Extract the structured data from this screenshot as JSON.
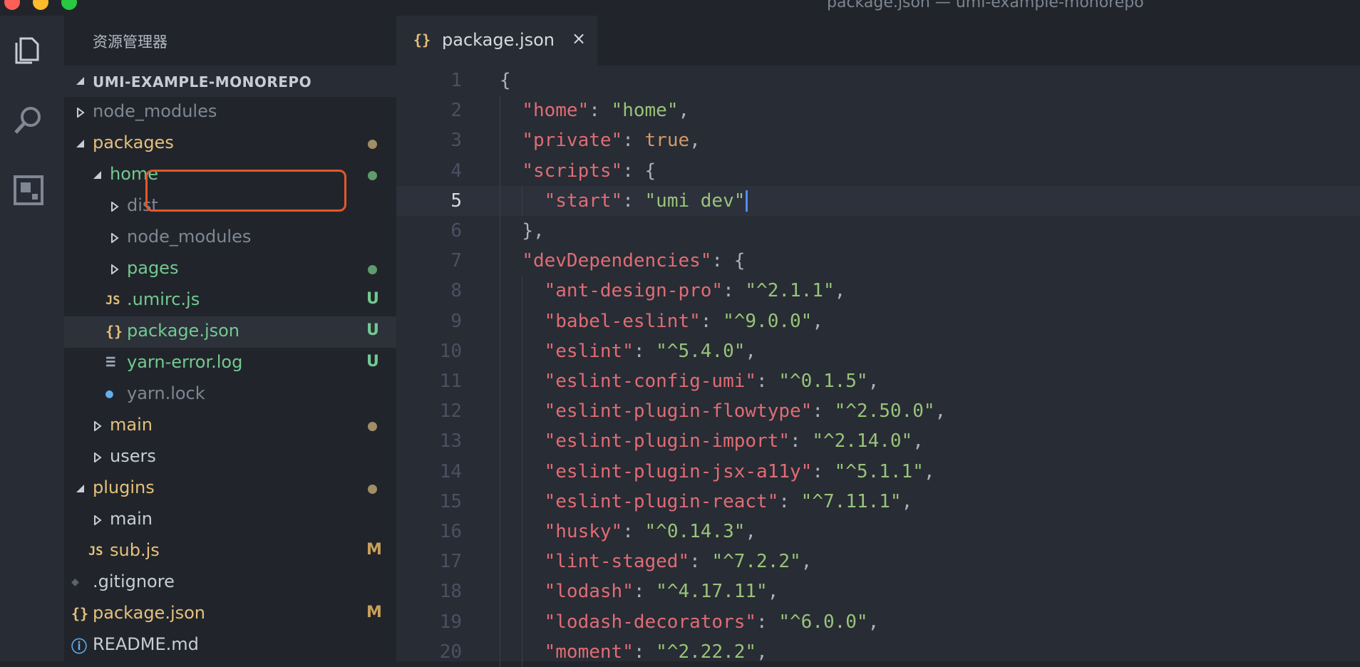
{
  "window": {
    "title": "package.json — umi-example-monorepo"
  },
  "colors": {
    "close": "#fe5f57",
    "minimize": "#febb2e",
    "zoom": "#28c840",
    "highlight_box": "#e2582b"
  },
  "activity_bar": {
    "icons": [
      "files-icon",
      "search-icon",
      "extensions-icon"
    ]
  },
  "sidebar": {
    "title": "资源管理器",
    "root": "UMI-EXAMPLE-MONOREPO",
    "items": [
      {
        "label": "node_modules",
        "indent": 1,
        "arrow": "right",
        "icon": "",
        "color": "#7f8794",
        "mark": "",
        "mark_type": ""
      },
      {
        "label": "packages",
        "indent": 1,
        "arrow": "down",
        "icon": "",
        "color": "#e5c07b",
        "mark": "",
        "mark_type": "dot",
        "mark_color": "#a18d66"
      },
      {
        "label": "home",
        "indent": 2,
        "arrow": "down",
        "icon": "",
        "color": "#73c991",
        "mark": "",
        "mark_type": "dot",
        "mark_color": "#5f9b6c"
      },
      {
        "label": "dist",
        "indent": 3,
        "arrow": "right",
        "icon": "",
        "color": "#7f8794",
        "mark": "",
        "mark_type": ""
      },
      {
        "label": "node_modules",
        "indent": 3,
        "arrow": "right",
        "icon": "",
        "color": "#7f8794",
        "mark": "",
        "mark_type": ""
      },
      {
        "label": "pages",
        "indent": 3,
        "arrow": "right",
        "icon": "",
        "color": "#73c991",
        "mark": "",
        "mark_type": "dot",
        "mark_color": "#5f9b6c"
      },
      {
        "label": ".umirc.js",
        "indent": 3,
        "arrow": "",
        "icon": "JS",
        "icon_color": "#e5c07b",
        "color": "#73c991",
        "mark": "U",
        "mark_type": "badge",
        "mark_color": "#73c991"
      },
      {
        "label": "package.json",
        "indent": 3,
        "arrow": "",
        "icon": "{}",
        "icon_color": "#e5c07b",
        "color": "#73c991",
        "mark": "U",
        "mark_type": "badge",
        "mark_color": "#73c991",
        "selected": true
      },
      {
        "label": "yarn-error.log",
        "indent": 3,
        "arrow": "",
        "icon": "≡",
        "icon_color": "#9da5b4",
        "color": "#73c991",
        "mark": "U",
        "mark_type": "badge",
        "mark_color": "#73c991"
      },
      {
        "label": "yarn.lock",
        "indent": 3,
        "arrow": "",
        "icon": "yarn",
        "icon_color": "#61afef",
        "color": "#7f8794",
        "mark": "",
        "mark_type": ""
      },
      {
        "label": "main",
        "indent": 2,
        "arrow": "right",
        "icon": "",
        "color": "#e5c07b",
        "mark": "",
        "mark_type": "dot",
        "mark_color": "#a18d66"
      },
      {
        "label": "users",
        "indent": 2,
        "arrow": "right",
        "icon": "",
        "color": "#c8ccd4",
        "mark": "",
        "mark_type": ""
      },
      {
        "label": "plugins",
        "indent": 1,
        "arrow": "down",
        "icon": "",
        "color": "#e5c07b",
        "mark": "",
        "mark_type": "dot",
        "mark_color": "#a18d66"
      },
      {
        "label": "main",
        "indent": 2,
        "arrow": "right",
        "icon": "",
        "color": "#c8ccd4",
        "mark": "",
        "mark_type": ""
      },
      {
        "label": "sub.js",
        "indent": 2,
        "arrow": "",
        "icon": "JS",
        "icon_color": "#e5c07b",
        "color": "#e5c07b",
        "mark": "M",
        "mark_type": "badge",
        "mark_color": "#c7a05a"
      },
      {
        "label": ".gitignore",
        "indent": 1,
        "arrow": "",
        "icon": "git",
        "icon_color": "#5c6370",
        "color": "#c8ccd4",
        "mark": "",
        "mark_type": ""
      },
      {
        "label": "package.json",
        "indent": 1,
        "arrow": "",
        "icon": "{}",
        "icon_color": "#e5c07b",
        "color": "#e5c07b",
        "mark": "M",
        "mark_type": "badge",
        "mark_color": "#c7a05a"
      },
      {
        "label": "README.md",
        "indent": 1,
        "arrow": "",
        "icon": "info",
        "icon_color": "#61afef",
        "color": "#c8ccd4",
        "mark": "",
        "mark_type": ""
      }
    ]
  },
  "tab": {
    "icon": "{}",
    "label": "package.json",
    "close": "×"
  },
  "editor": {
    "active_line": 5,
    "lines": [
      {
        "n": 1,
        "depth": 0,
        "tokens": [
          [
            "p",
            "{"
          ]
        ]
      },
      {
        "n": 2,
        "depth": 1,
        "tokens": [
          [
            "k",
            "\"home\""
          ],
          [
            "p",
            ": "
          ],
          [
            "s",
            "\"home\""
          ],
          [
            "p",
            ","
          ]
        ]
      },
      {
        "n": 3,
        "depth": 1,
        "tokens": [
          [
            "k",
            "\"private\""
          ],
          [
            "p",
            ": "
          ],
          [
            "b",
            "true"
          ],
          [
            "p",
            ","
          ]
        ]
      },
      {
        "n": 4,
        "depth": 1,
        "tokens": [
          [
            "k",
            "\"scripts\""
          ],
          [
            "p",
            ": {"
          ]
        ]
      },
      {
        "n": 5,
        "depth": 2,
        "tokens": [
          [
            "k",
            "\"start\""
          ],
          [
            "p",
            ": "
          ],
          [
            "s",
            "\"umi dev\""
          ]
        ],
        "cursor": true
      },
      {
        "n": 6,
        "depth": 1,
        "tokens": [
          [
            "p",
            "},"
          ]
        ]
      },
      {
        "n": 7,
        "depth": 1,
        "tokens": [
          [
            "k",
            "\"devDependencies\""
          ],
          [
            "p",
            ": {"
          ]
        ]
      },
      {
        "n": 8,
        "depth": 2,
        "tokens": [
          [
            "k",
            "\"ant-design-pro\""
          ],
          [
            "p",
            ": "
          ],
          [
            "s",
            "\"^2.1.1\""
          ],
          [
            "p",
            ","
          ]
        ]
      },
      {
        "n": 9,
        "depth": 2,
        "tokens": [
          [
            "k",
            "\"babel-eslint\""
          ],
          [
            "p",
            ": "
          ],
          [
            "s",
            "\"^9.0.0\""
          ],
          [
            "p",
            ","
          ]
        ]
      },
      {
        "n": 10,
        "depth": 2,
        "tokens": [
          [
            "k",
            "\"eslint\""
          ],
          [
            "p",
            ": "
          ],
          [
            "s",
            "\"^5.4.0\""
          ],
          [
            "p",
            ","
          ]
        ]
      },
      {
        "n": 11,
        "depth": 2,
        "tokens": [
          [
            "k",
            "\"eslint-config-umi\""
          ],
          [
            "p",
            ": "
          ],
          [
            "s",
            "\"^0.1.5\""
          ],
          [
            "p",
            ","
          ]
        ]
      },
      {
        "n": 12,
        "depth": 2,
        "tokens": [
          [
            "k",
            "\"eslint-plugin-flowtype\""
          ],
          [
            "p",
            ": "
          ],
          [
            "s",
            "\"^2.50.0\""
          ],
          [
            "p",
            ","
          ]
        ]
      },
      {
        "n": 13,
        "depth": 2,
        "tokens": [
          [
            "k",
            "\"eslint-plugin-import\""
          ],
          [
            "p",
            ": "
          ],
          [
            "s",
            "\"^2.14.0\""
          ],
          [
            "p",
            ","
          ]
        ]
      },
      {
        "n": 14,
        "depth": 2,
        "tokens": [
          [
            "k",
            "\"eslint-plugin-jsx-a11y\""
          ],
          [
            "p",
            ": "
          ],
          [
            "s",
            "\"^5.1.1\""
          ],
          [
            "p",
            ","
          ]
        ]
      },
      {
        "n": 15,
        "depth": 2,
        "tokens": [
          [
            "k",
            "\"eslint-plugin-react\""
          ],
          [
            "p",
            ": "
          ],
          [
            "s",
            "\"^7.11.1\""
          ],
          [
            "p",
            ","
          ]
        ]
      },
      {
        "n": 16,
        "depth": 2,
        "tokens": [
          [
            "k",
            "\"husky\""
          ],
          [
            "p",
            ": "
          ],
          [
            "s",
            "\"^0.14.3\""
          ],
          [
            "p",
            ","
          ]
        ]
      },
      {
        "n": 17,
        "depth": 2,
        "tokens": [
          [
            "k",
            "\"lint-staged\""
          ],
          [
            "p",
            ": "
          ],
          [
            "s",
            "\"^7.2.2\""
          ],
          [
            "p",
            ","
          ]
        ]
      },
      {
        "n": 18,
        "depth": 2,
        "tokens": [
          [
            "k",
            "\"lodash\""
          ],
          [
            "p",
            ": "
          ],
          [
            "s",
            "\"^4.17.11\""
          ],
          [
            "p",
            ","
          ]
        ]
      },
      {
        "n": 19,
        "depth": 2,
        "tokens": [
          [
            "k",
            "\"lodash-decorators\""
          ],
          [
            "p",
            ": "
          ],
          [
            "s",
            "\"^6.0.0\""
          ],
          [
            "p",
            ","
          ]
        ]
      },
      {
        "n": 20,
        "depth": 2,
        "tokens": [
          [
            "k",
            "\"moment\""
          ],
          [
            "p",
            ": "
          ],
          [
            "s",
            "\"^2.22.2\""
          ],
          [
            "p",
            ","
          ]
        ]
      }
    ]
  }
}
